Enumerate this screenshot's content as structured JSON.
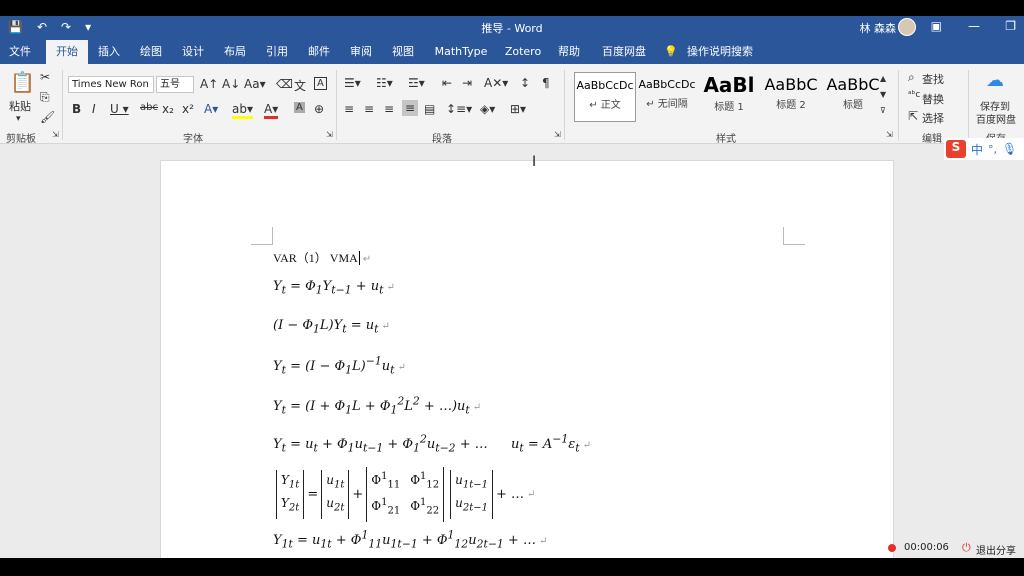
{
  "titlebar": {
    "document_title": "推导 - Word",
    "user_name": "林 森森",
    "quick_access": [
      "save-icon",
      "undo-icon",
      "redo-icon",
      "customize-icon"
    ],
    "window_buttons": [
      "ribbon-display-icon",
      "minimize-icon",
      "restore-icon"
    ]
  },
  "tabs": [
    "文件",
    "开始",
    "插入",
    "绘图",
    "设计",
    "布局",
    "引用",
    "邮件",
    "审阅",
    "视图",
    "MathType",
    "Zotero",
    "帮助",
    "百度网盘",
    "操作说明搜索"
  ],
  "active_tab": "开始",
  "ribbon": {
    "clipboard": {
      "paste_label": "粘贴",
      "group_label": "剪贴板"
    },
    "font": {
      "font_name": "Times New Ron",
      "font_size": "五号",
      "group_label": "字体"
    },
    "paragraph": {
      "group_label": "段落"
    },
    "styles": {
      "group_label": "样式",
      "items": [
        {
          "sample": "AaBbCcDc",
          "name": "↵ 正文"
        },
        {
          "sample": "AaBbCcDc",
          "name": "↵ 无间隔"
        },
        {
          "sample": "AaBl",
          "name": "标题 1"
        },
        {
          "sample": "AaBbC",
          "name": "标题 2"
        },
        {
          "sample": "AaBbC",
          "name": "标题"
        }
      ]
    },
    "editing": {
      "find": "查找",
      "replace": "替换",
      "select": "选择",
      "group_label": "编辑"
    },
    "save": {
      "label_line1": "保存到",
      "label_line2": "百度网盘",
      "group_label": "保存"
    }
  },
  "ime": {
    "cn": "中",
    "punct": "°,"
  },
  "document": {
    "heading": "VAR（1）  VMA",
    "equations": [
      "Y_t = Φ_1 Y_{t−1} + u_t",
      "(I − Φ_1 L) Y_t = u_t",
      "Y_t = (I − Φ_1 L)^{−1} u_t",
      "Y_t = (I + Φ_1 L + Φ_1^2 L^2 + …) u_t",
      "Y_t = u_t + Φ_1 u_{t−1} + Φ_1^2 u_{t−2} + …",
      "u_t = A^{−1} ε_t",
      "Y_{1t} = u_{1t} + Φ^1_{11} u_{1t−1} + Φ^1_{12} u_{2t−1} + …"
    ]
  },
  "status": {
    "recording_time": "00:00:06",
    "exit_share": "退出分享"
  },
  "colors": {
    "word_blue": "#2b579a",
    "ribbon_bg": "#f3f3f3",
    "canvas_bg": "#ebebeb",
    "record_red": "#e0302a"
  }
}
